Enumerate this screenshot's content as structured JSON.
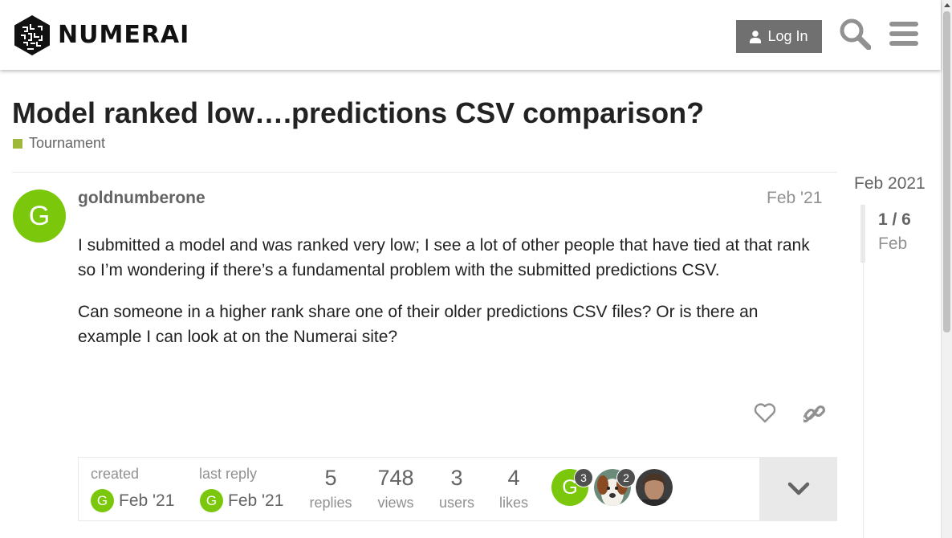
{
  "header": {
    "brand": "NUMERAI",
    "login_label": "Log In",
    "icons": [
      "user-icon",
      "search-icon",
      "hamburger-menu-icon"
    ]
  },
  "topic": {
    "title": "Model ranked low….predictions CSV comparison?",
    "category": "Tournament",
    "category_color": "#9eb83b"
  },
  "post": {
    "avatar_letter": "G",
    "avatar_color": "#7ac70c",
    "username": "goldnumberone",
    "date": "Feb '21",
    "paragraphs": [
      "I submitted a model and was ranked very low; I see a lot of other people that have tied at that rank so I’m wondering if there’s a fundamental problem with the submitted predictions CSV.",
      "Can someone in a higher rank share one of their older predictions CSV files? Or is there an example I can look at on the Numerai site?"
    ]
  },
  "topic_map": {
    "created_label": "created",
    "created_date": "Feb '21",
    "last_reply_label": "last reply",
    "last_reply_date": "Feb '21",
    "replies": "5",
    "replies_label": "replies",
    "views": "748",
    "views_label": "views",
    "users": "3",
    "users_label": "users",
    "likes": "4",
    "likes_label": "likes",
    "participants": [
      {
        "letter": "G",
        "count": "3"
      },
      {
        "letter": "",
        "count": "2"
      },
      {
        "letter": "",
        "count": ""
      }
    ]
  },
  "timeline": {
    "date": "Feb 2021",
    "position": "1 / 6",
    "sub": "Feb"
  }
}
